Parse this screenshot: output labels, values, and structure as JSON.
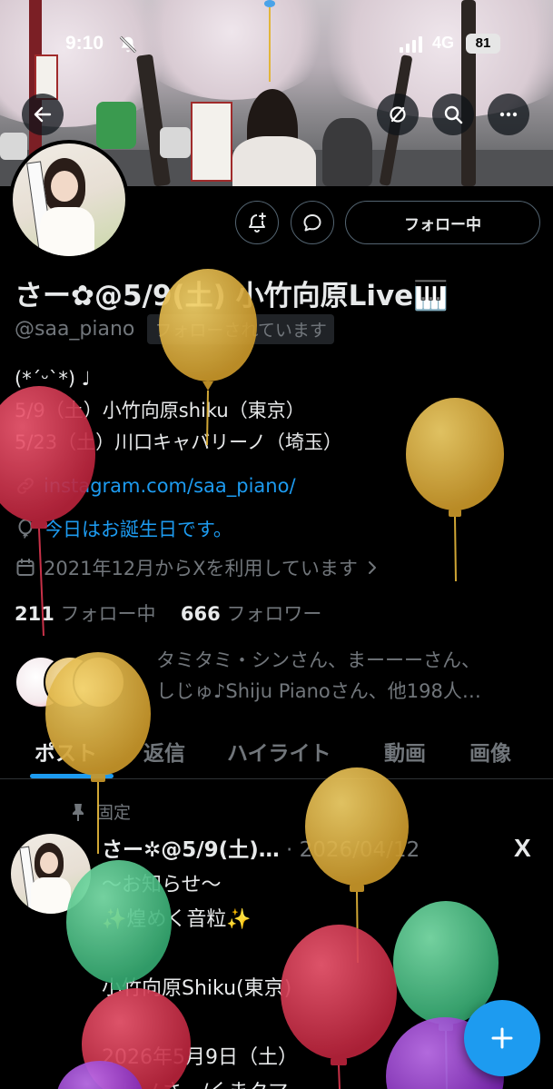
{
  "status_bar": {
    "time": "9:10",
    "network": "4G",
    "battery": "81"
  },
  "header": {
    "back_icon": "arrow-left-icon",
    "icons": [
      "translate-off-icon",
      "search-icon",
      "more-icon"
    ]
  },
  "profile": {
    "follow_button": "フォロー中",
    "name": "さー✿@5/9(土) 小竹向原Live🎹",
    "handle": "@saa_piano",
    "follows_you": "フォローされています",
    "bio_lines": [
      "(*´ᵕ`*) ♩",
      "5/9（土）小竹向原shiku（東京）",
      "5/23（土）川口キャバリーノ（埼玉）"
    ],
    "link": "instagram.com/saa_piano/",
    "birthday": "今日はお誕生日です。",
    "joined": "2021年12月からXを利用しています",
    "following_count": "211",
    "following_label": "フォロー中",
    "followers_count": "666",
    "followers_label": "フォロワー",
    "known_followers_line1": "タミタミ・シンさん、まーーーさん、",
    "known_followers_line2": "しじゅ♪Shiju Pianoさん、他198人…"
  },
  "tabs": [
    "ポスト",
    "返信",
    "ハイライト",
    "動画",
    "画像"
  ],
  "active_tab": "ポスト",
  "post": {
    "pinned_label": "固定",
    "author": "さー✲@5/9(土)…",
    "date": "· 2026/04/12",
    "x_logo": "X",
    "body": "〜お知らせ〜\n✨煌めく音粒✨\n\n小竹向原Shiku(東京)\n\n2026年5月9日（土）\n〜はノさー/くまクマ"
  },
  "colors": {
    "accent": "#1d9bf0",
    "balloon_yellow": "#e2b53a",
    "balloon_red": "#d9364f",
    "balloon_green": "#4fc98c",
    "balloon_purple": "#9b3fd1"
  }
}
